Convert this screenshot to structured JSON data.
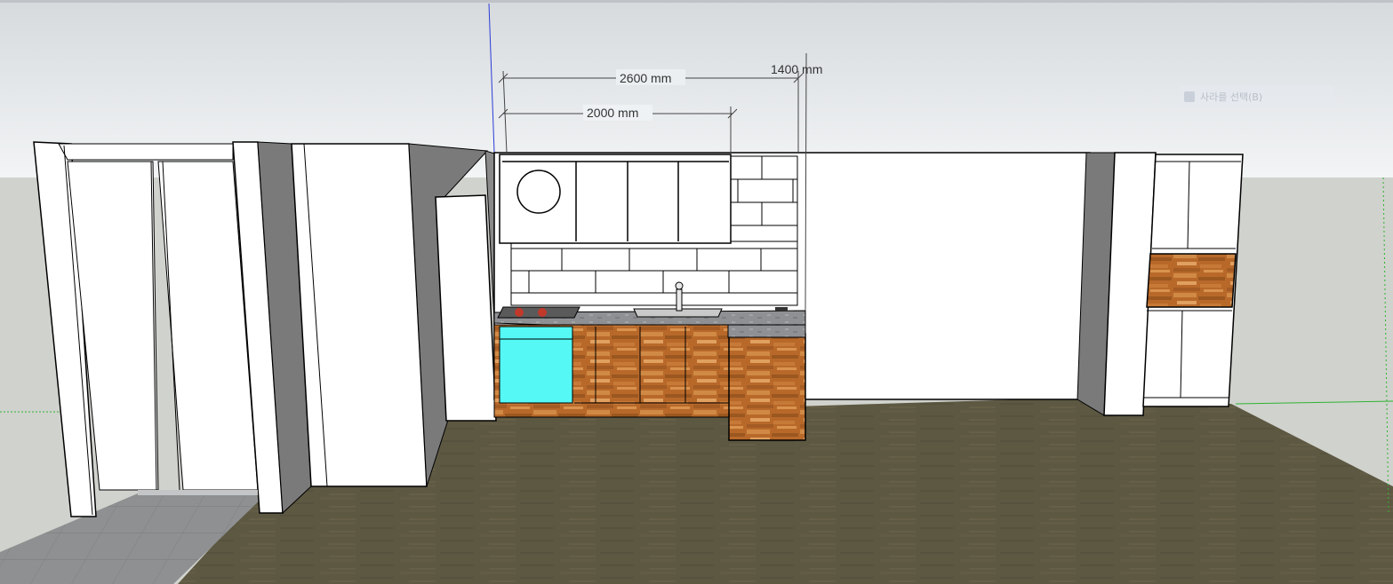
{
  "viewport": {
    "dimensions": [
      {
        "id": "dim-2600",
        "label": "2600 mm"
      },
      {
        "id": "dim-2000",
        "label": "2000 mm"
      },
      {
        "id": "dim-1400",
        "label": "1400 mm"
      }
    ],
    "hint_chip": {
      "label": "사라를 선택(B)"
    },
    "colors": {
      "sky": "#e6ecef",
      "ground": "#cfd1cc",
      "floor": "#5b5640",
      "tile_floor": "#8c8d8e",
      "wall": "#ffffff",
      "wall_shadow": "#7a7a7a",
      "wood": "#b46a2c",
      "cyan_panel": "#55f8f4",
      "countertop": "#8b8d90",
      "axis_blue": "#2b3bd6",
      "axis_green": "#2fb332"
    }
  }
}
